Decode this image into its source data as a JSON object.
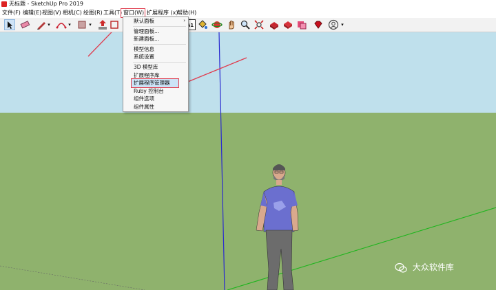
{
  "window": {
    "title": "无标题 - SketchUp Pro 2019"
  },
  "menubar": [
    {
      "label": "文件(F)"
    },
    {
      "label": "编辑(E)"
    },
    {
      "label": "视图(V)"
    },
    {
      "label": "相机(C)"
    },
    {
      "label": "绘图(R)"
    },
    {
      "label": "工具(T)"
    },
    {
      "label": "窗口(W)"
    },
    {
      "label": "扩展程序 (x)"
    },
    {
      "label": "帮助(H)"
    }
  ],
  "dropdown": {
    "items": [
      {
        "label": "默认面板",
        "submenu": true
      },
      {
        "label": "管理面板..."
      },
      {
        "label": "新建面板..."
      },
      {
        "label": "模型信息"
      },
      {
        "label": "系统设置"
      },
      {
        "label": "3D 模型库"
      },
      {
        "label": "扩展程序库"
      },
      {
        "label": "扩展程序管理器",
        "highlighted": true
      },
      {
        "label": "Ruby 控制台"
      },
      {
        "label": "组件选项"
      },
      {
        "label": "组件属性"
      }
    ]
  },
  "toolbar": {
    "icons": [
      "select-tool-icon",
      "eraser-tool-icon",
      "pencil-tool-icon",
      "arc-tool-icon",
      "rectangle-tool-icon",
      "push-pull-tool-icon",
      "scale-tool-icon",
      "text-tool-icon",
      "paint-bucket-icon",
      "orbit-icon",
      "pan-icon",
      "zoom-icon",
      "zoom-extents-icon",
      "warehouse-icon",
      "extension-warehouse-icon",
      "send-to-layout-icon",
      "ruby-gem-icon",
      "account-icon"
    ],
    "text_tool_label": "A1"
  },
  "watermark": {
    "text": "大众软件库"
  },
  "colors": {
    "ground": "#8fb26d",
    "sky": "#bfe0ec",
    "highlight": "#e03c4e",
    "axis_blue": "#2a2ad0",
    "axis_green": "#1db51d"
  }
}
